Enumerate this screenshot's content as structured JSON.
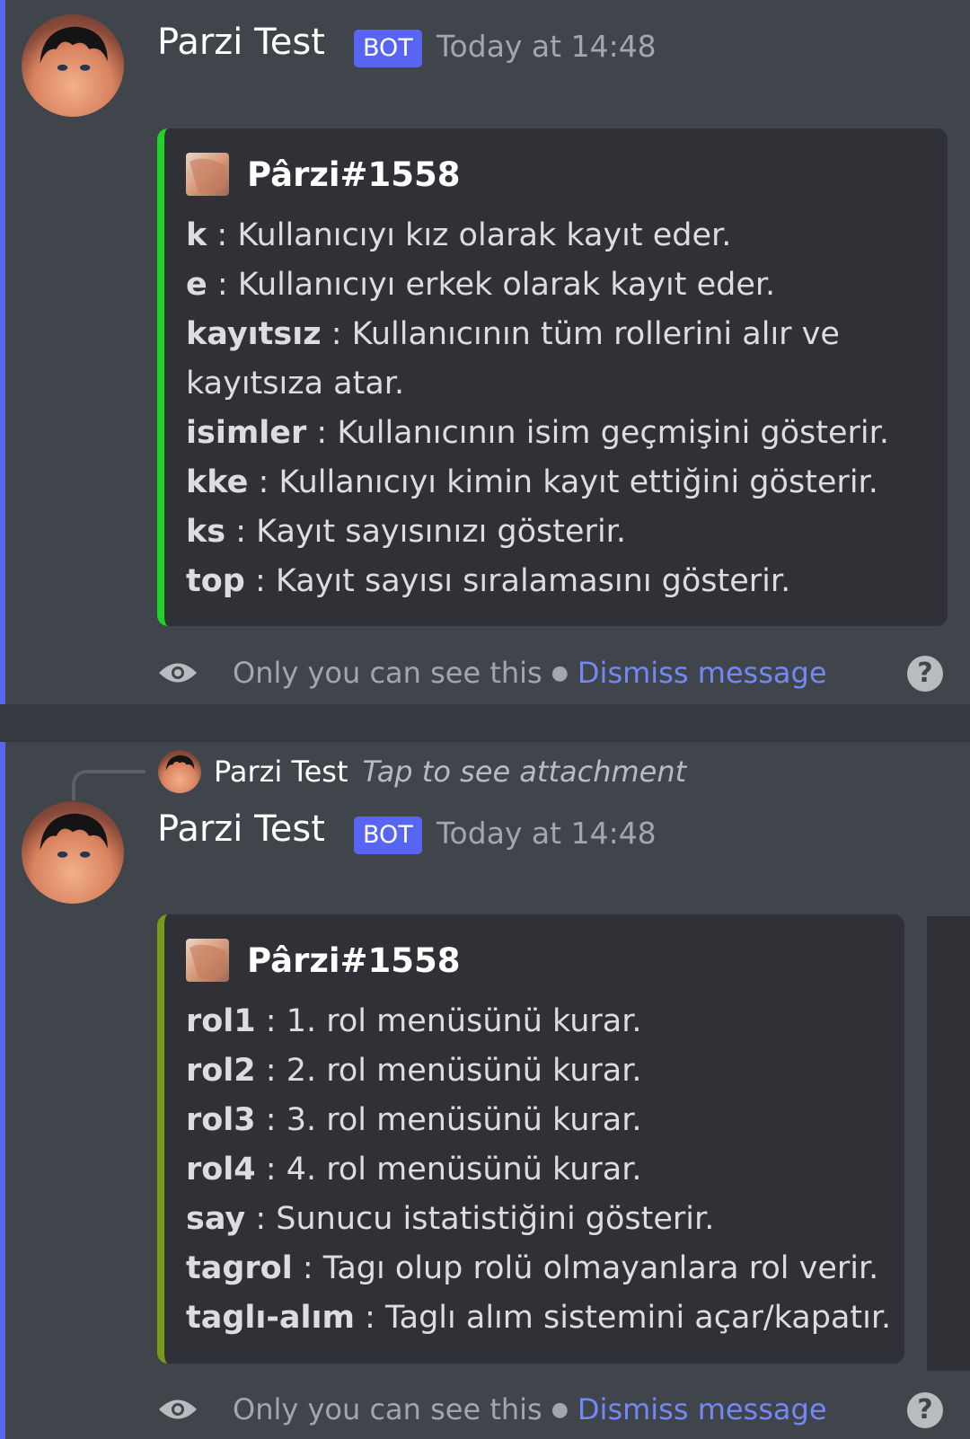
{
  "colors": {
    "bg": "#36393f",
    "message_bg": "#40444b",
    "mention_accent": "#5865f2",
    "embed_bg": "#2f3136",
    "embed1_color": "#1fd426",
    "embed2_color": "#7a9a1a",
    "link": "#7289f5"
  },
  "messages": [
    {
      "username": "Parzi Test",
      "bot_tag": "BOT",
      "timestamp": "Today at 14:48",
      "embed": {
        "author": "Pârzi#1558",
        "lines": [
          {
            "cmd": "k",
            "desc": " : Kullanıcıyı kız olarak kayıt eder."
          },
          {
            "cmd": "e",
            "desc": " : Kullanıcıyı erkek olarak kayıt eder."
          },
          {
            "cmd": "kayıtsız",
            "desc": " : Kullanıcının tüm rollerini alır ve"
          },
          {
            "cmd": "",
            "desc": "kayıtsıza atar."
          },
          {
            "cmd": "isimler",
            "desc": " : Kullanıcının isim geçmişini gösterir."
          },
          {
            "cmd": "kke",
            "desc": " : Kullanıcıyı kimin kayıt ettiğini gösterir."
          },
          {
            "cmd": "ks",
            "desc": " : Kayıt sayısınızı gösterir."
          },
          {
            "cmd": "top",
            "desc": " : Kayıt sayısı sıralamasını gösterir."
          }
        ]
      },
      "ephemeral_text": "Only you can see this",
      "dismiss_label": "Dismiss message",
      "help_label": "?"
    },
    {
      "reply": {
        "username": "Parzi Test",
        "text": "Tap to see attachment"
      },
      "username": "Parzi Test",
      "bot_tag": "BOT",
      "timestamp": "Today at 14:48",
      "embed": {
        "author": "Pârzi#1558",
        "lines": [
          {
            "cmd": "rol1",
            "desc": " : 1. rol menüsünü kurar."
          },
          {
            "cmd": "rol2",
            "desc": " : 2. rol menüsünü kurar."
          },
          {
            "cmd": "rol3",
            "desc": " : 3. rol menüsünü kurar."
          },
          {
            "cmd": "rol4",
            "desc": " : 4. rol menüsünü kurar."
          },
          {
            "cmd": "say",
            "desc": " : Sunucu istatistiğini gösterir."
          },
          {
            "cmd": "tagrol",
            "desc": " : Tagı olup rolü olmayanlara rol verir."
          },
          {
            "cmd": "taglı-alım",
            "desc": " : Taglı alım sistemini açar/kapatır."
          }
        ]
      },
      "ephemeral_text": "Only you can see this",
      "dismiss_label": "Dismiss message",
      "help_label": "?"
    }
  ]
}
